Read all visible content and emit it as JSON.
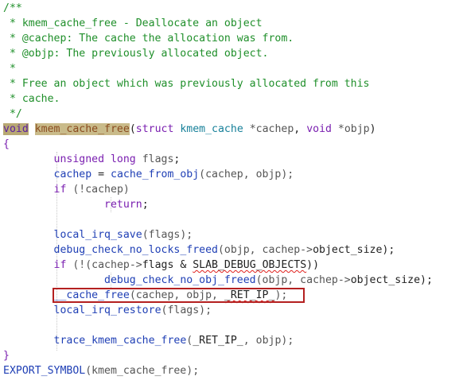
{
  "editor": {
    "comment": [
      "/**",
      " * kmem_cache_free - Deallocate an object",
      " * @cachep: The cache the allocation was from.",
      " * @objp: The previously allocated object.",
      " *",
      " * Free an object which was previously allocated from this",
      " * cache.",
      " */"
    ],
    "signature": {
      "ret_type": "void",
      "name": "kmem_cache_free",
      "open_paren": "(",
      "struct_kw": "struct",
      "struct_type": "kmem_cache",
      "param1": " *cachep",
      "comma": ", ",
      "void_kw": "void",
      "param2": " *objp",
      "close": ")"
    },
    "open_brace": "{",
    "decl": {
      "indent": "        ",
      "type": "unsigned long",
      "var": " flags",
      "semi": ";"
    },
    "assign": {
      "indent": "        ",
      "lhs": "cachep",
      "eq": " = ",
      "fn": "cache_from_obj",
      "args": "(cachep, objp);"
    },
    "if1": {
      "indent": "        ",
      "kw": "if",
      "cond": " (!cachep)"
    },
    "return_stmt": {
      "indent": "                ",
      "kw": "return",
      "semi": ";"
    },
    "irq_save": {
      "indent": "        ",
      "fn": "local_irq_save",
      "args": "(flags);"
    },
    "debug_locks": {
      "indent": "        ",
      "fn": "debug_check_no_locks_freed",
      "args_a": "(objp, cachep->",
      "member": "object_size",
      "args_b": ");"
    },
    "if2": {
      "indent": "        ",
      "kw": "if",
      "a": " (!(cachep->",
      "member": "flags",
      "b": " & ",
      "macro": "SLAB_DEBUG_OBJECTS",
      "c": "))"
    },
    "debug_obj": {
      "indent": "                ",
      "fn": "debug_check_no_obj_freed",
      "args_a": "(objp, cachep->",
      "member": "object_size",
      "args_b": ");"
    },
    "cache_free": {
      "indent": "        ",
      "fn": "__cache_free",
      "args_a": "(cachep, objp, ",
      "macro": "_RET_IP_",
      "args_b": ");"
    },
    "irq_restore": {
      "indent": "        ",
      "fn": "local_irq_restore",
      "args": "(flags);"
    },
    "trace": {
      "indent": "        ",
      "fn": "trace_kmem_cache_free",
      "a": "(",
      "macro": "_RET_IP_",
      "b": ", objp);"
    },
    "close_brace": "}",
    "export": {
      "macro": "EXPORT_SYMBOL",
      "args": "(kmem_cache_free);"
    }
  },
  "colors": {
    "comment": "#1f8f2a",
    "keyword": "#7a1fb0",
    "type": "#18819a",
    "function": "#1f3fb5",
    "highlight_box": "#b42020",
    "squiggle": "#e0201c"
  }
}
